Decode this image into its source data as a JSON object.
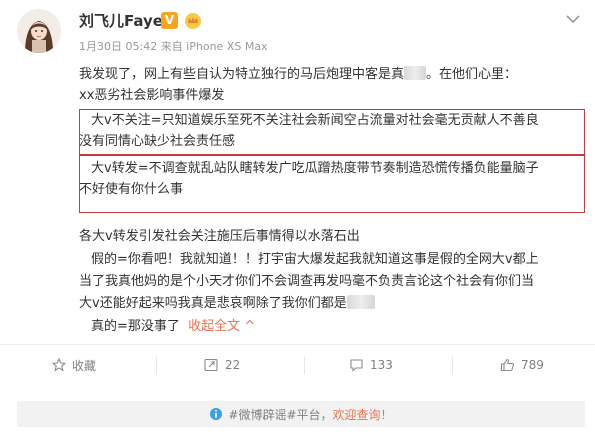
{
  "post": {
    "author": "刘飞儿Faye",
    "meta": "1月30日 05:42 来自 iPhone XS Max",
    "paragraphs": {
      "p1": "我发现了，网上有些自认为特立独行的马后炮理中客是真",
      "p1_end": "。在他们心里：",
      "p2": "xx恶劣社会影响事件爆发",
      "box1_line1": "大v不关注=只知道娱乐至死不关注社会新闻空占流量对社会毫无贡献人不善良",
      "box1_line2": "没有同情心缺少社会责任感",
      "box2_line1": "大v转发=不调查就乱站队瞎转发广吃瓜蹭热度带节奏制造恐慌传播负能量脑子",
      "box2_line2": "不好使有你什么事",
      "p3": "各大v转发引发社会关注施压后事情得以水落石出",
      "p4_line1": "假的=你看吧！我就知道！！打宇宙大爆发起我就知道这事是假的全网大v都上",
      "p4_line2": "当了我真他妈的是个小天才你们不会调查再发吗毫不负责言论这个社会有你们当",
      "p4_line3_pre": "大v还能好起来吗我真是悲哀啊除了我你们都是",
      "p5_pre": "真的=那没事了",
      "expand": "收起全文",
      "expand_caret": "^"
    }
  },
  "actions": {
    "favorite": "收藏",
    "repost": "22",
    "comment": "133",
    "like": "789"
  },
  "tip": {
    "text_pre": "#微博辟谣#平台，",
    "link": "欢迎查询！"
  },
  "colors": {
    "highlight_box": "#c33c3c",
    "link": "#eb7350",
    "verified": "#f6a623"
  }
}
